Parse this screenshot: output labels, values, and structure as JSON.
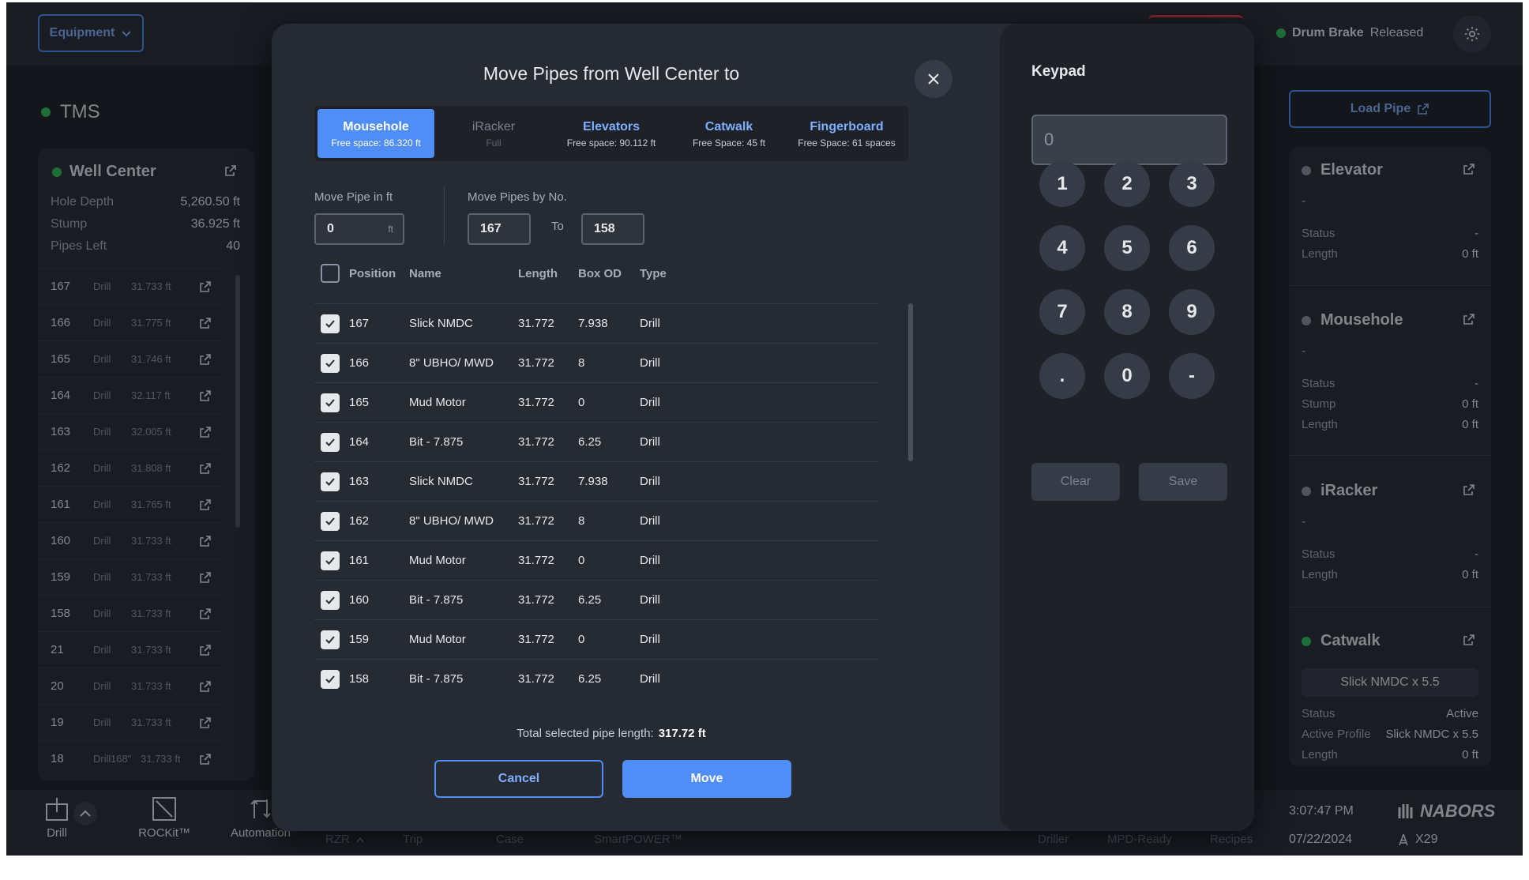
{
  "topbar": {
    "equipment_label": "Equipment",
    "brake_label": "Drum Brake",
    "brake_status": "Released"
  },
  "tms": {
    "label": "TMS"
  },
  "well_center": {
    "title": "Well Center",
    "stats": [
      {
        "label": "Hole Depth",
        "value": "5,260.50 ft"
      },
      {
        "label": "Stump",
        "value": "36.925 ft"
      },
      {
        "label": "Pipes Left",
        "value": "40"
      }
    ],
    "rows": [
      {
        "pos": "167",
        "type": "Drill",
        "len": "31.733 ft",
        "extra": ""
      },
      {
        "pos": "166",
        "type": "Drill",
        "len": "31.775 ft",
        "extra": ""
      },
      {
        "pos": "165",
        "type": "Drill",
        "len": "31.746 ft",
        "extra": ""
      },
      {
        "pos": "164",
        "type": "Drill",
        "len": "32.117 ft",
        "extra": ""
      },
      {
        "pos": "163",
        "type": "Drill",
        "len": "32.005 ft",
        "extra": ""
      },
      {
        "pos": "162",
        "type": "Drill",
        "len": "31.808 ft",
        "extra": ""
      },
      {
        "pos": "161",
        "type": "Drill",
        "len": "31.765 ft",
        "extra": ""
      },
      {
        "pos": "160",
        "type": "Drill",
        "len": "31.733 ft",
        "extra": ""
      },
      {
        "pos": "159",
        "type": "Drill",
        "len": "31.733 ft",
        "extra": ""
      },
      {
        "pos": "158",
        "type": "Drill",
        "len": "31.733 ft",
        "extra": ""
      },
      {
        "pos": "21",
        "type": "Drill",
        "len": "31.733 ft",
        "extra": ""
      },
      {
        "pos": "20",
        "type": "Drill",
        "len": "31.733 ft",
        "extra": ""
      },
      {
        "pos": "19",
        "type": "Drill",
        "len": "31.733 ft",
        "extra": ""
      },
      {
        "pos": "18",
        "type": "Drill",
        "len": "31.733 ft",
        "extra": "168\""
      }
    ]
  },
  "right_panel": {
    "load_pipe_label": "Load Pipe",
    "elevator": {
      "title": "Elevator",
      "dash": "-",
      "status_label": "Status",
      "status_value": "-",
      "length_label": "Length",
      "length_value": "0 ft"
    },
    "mousehole": {
      "title": "Mousehole",
      "dash": "-",
      "status_label": "Status",
      "status_value": "-",
      "stump_label": "Stump",
      "stump_value": "0 ft",
      "length_label": "Length",
      "length_value": "0 ft"
    },
    "iracker": {
      "title": "iRacker",
      "dash": "-",
      "status_label": "Status",
      "status_value": "-",
      "length_label": "Length",
      "length_value": "0 ft"
    },
    "catwalk": {
      "title": "Catwalk",
      "profile": "Slick NMDC x 5.5",
      "status_label": "Status",
      "status_value": "Active",
      "profile_label": "Active Profile",
      "profile_value": "Slick NMDC x 5.5",
      "length_label": "Length",
      "length_value": "0 ft"
    }
  },
  "bottombar": {
    "nav": [
      {
        "label": "Drill"
      },
      {
        "label": "ROCKit™"
      },
      {
        "label": "Automation"
      }
    ],
    "dim_items": [
      "RZR",
      "Trip",
      "Case",
      "SmartPOWER™",
      "Driller",
      "MPD-Ready",
      "Recipes"
    ],
    "time": "3:07:47 PM",
    "date": "07/22/2024",
    "brand": "NABORS",
    "rig": "X29"
  },
  "modal": {
    "title": "Move Pipes from Well Center to",
    "tabs": [
      {
        "name": "Mousehole",
        "sub": "Free space: 86.320 ft"
      },
      {
        "name": "iRacker",
        "sub": "Full"
      },
      {
        "name": "Elevators",
        "sub": "Free space: 90.112 ft"
      },
      {
        "name": "Catwalk",
        "sub": "Free Space: 45 ft"
      },
      {
        "name": "Fingerboard",
        "sub": "Free Space: 61 spaces"
      }
    ],
    "move_ft_label": "Move Pipe in ft",
    "move_ft_value": "0",
    "move_ft_unit": "ft",
    "move_no_label": "Move Pipes by No.",
    "from_value": "167",
    "to_label": "To",
    "to_value": "158",
    "columns": [
      "Position",
      "Name",
      "Length",
      "Box OD",
      "Type"
    ],
    "rows": [
      {
        "pos": "167",
        "name": "Slick NMDC",
        "len": "31.772",
        "od": "7.938",
        "type": "Drill"
      },
      {
        "pos": "166",
        "name": "8\" UBHO/ MWD",
        "len": "31.772",
        "od": "8",
        "type": "Drill"
      },
      {
        "pos": "165",
        "name": "Mud Motor",
        "len": "31.772",
        "od": "0",
        "type": "Drill"
      },
      {
        "pos": "164",
        "name": "Bit - 7.875",
        "len": "31.772",
        "od": "6.25",
        "type": "Drill"
      },
      {
        "pos": "163",
        "name": "Slick NMDC",
        "len": "31.772",
        "od": "7.938",
        "type": "Drill"
      },
      {
        "pos": "162",
        "name": "8\" UBHO/ MWD",
        "len": "31.772",
        "od": "8",
        "type": "Drill"
      },
      {
        "pos": "161",
        "name": "Mud Motor",
        "len": "31.772",
        "od": "0",
        "type": "Drill"
      },
      {
        "pos": "160",
        "name": "Bit - 7.875",
        "len": "31.772",
        "od": "6.25",
        "type": "Drill"
      },
      {
        "pos": "159",
        "name": "Mud Motor",
        "len": "31.772",
        "od": "0",
        "type": "Drill"
      },
      {
        "pos": "158",
        "name": "Bit - 7.875",
        "len": "31.772",
        "od": "6.25",
        "type": "Drill"
      }
    ],
    "total_label": "Total selected pipe length:",
    "total_value": "317.72 ft",
    "cancel_label": "Cancel",
    "move_label": "Move"
  },
  "keypad": {
    "title": "Keypad",
    "display": "0",
    "keys": [
      "1",
      "2",
      "3",
      "4",
      "5",
      "6",
      "7",
      "8",
      "9",
      ".",
      "0",
      "-"
    ],
    "clear_label": "Clear",
    "save_label": "Save"
  },
  "colors": {
    "accent": "#4f8ef7",
    "status_green": "#2fbf5a",
    "bg": "#1b1f25",
    "panel": "#262b33"
  }
}
